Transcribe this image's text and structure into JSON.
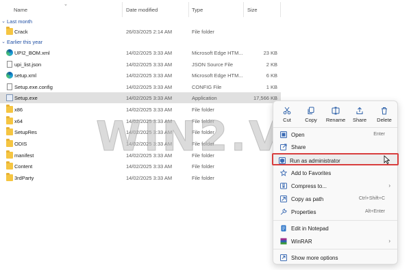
{
  "columns": {
    "name": "Name",
    "date": "Date modified",
    "type": "Type",
    "size": "Size"
  },
  "groups": {
    "last_month": {
      "label": "Last month"
    },
    "earlier": {
      "label": "Earlier this year"
    }
  },
  "files": [
    {
      "name": "Crack",
      "date": "26/03/2025 2:14 AM",
      "type": "File folder",
      "size": "",
      "icon": "folder-icon"
    },
    {
      "name": "UPI2_BOM.xml",
      "date": "14/02/2025 3:33 AM",
      "type": "Microsoft Edge HTM...",
      "size": "23 KB",
      "icon": "edge-icon"
    },
    {
      "name": "upi_list.json",
      "date": "14/02/2025 3:33 AM",
      "type": "JSON Source File",
      "size": "2 KB",
      "icon": "document-icon"
    },
    {
      "name": "setup.xml",
      "date": "14/02/2025 3:33 AM",
      "type": "Microsoft Edge HTM...",
      "size": "6 KB",
      "icon": "edge-icon"
    },
    {
      "name": "Setup.exe.config",
      "date": "14/02/2025 3:33 AM",
      "type": "CONFIG File",
      "size": "1 KB",
      "icon": "document-icon"
    },
    {
      "name": "Setup.exe",
      "date": "14/02/2025 3:33 AM",
      "type": "Application",
      "size": "17,566 KB",
      "icon": "application-icon"
    },
    {
      "name": "x86",
      "date": "14/02/2025 3:33 AM",
      "type": "File folder",
      "size": "",
      "icon": "folder-icon"
    },
    {
      "name": "x64",
      "date": "14/02/2025 3:33 AM",
      "type": "File folder",
      "size": "",
      "icon": "folder-icon"
    },
    {
      "name": "SetupRes",
      "date": "14/02/2025 3:33 AM",
      "type": "File folder",
      "size": "",
      "icon": "folder-icon"
    },
    {
      "name": "ODIS",
      "date": "14/02/2025 3:33 AM",
      "type": "File folder",
      "size": "",
      "icon": "folder-icon"
    },
    {
      "name": "manifest",
      "date": "14/02/2025 3:33 AM",
      "type": "File folder",
      "size": "",
      "icon": "folder-icon"
    },
    {
      "name": "Content",
      "date": "14/02/2025 3:33 AM",
      "type": "File folder",
      "size": "",
      "icon": "folder-icon"
    },
    {
      "name": "3rdParty",
      "date": "14/02/2025 3:33 AM",
      "type": "File folder",
      "size": "",
      "icon": "folder-icon"
    }
  ],
  "watermark": "WIN2.VN",
  "context_menu": {
    "quick_actions": [
      {
        "label": "Cut",
        "icon": "scissors-icon"
      },
      {
        "label": "Copy",
        "icon": "copy-icon"
      },
      {
        "label": "Rename",
        "icon": "rename-icon"
      },
      {
        "label": "Share",
        "icon": "share-icon"
      },
      {
        "label": "Delete",
        "icon": "trash-icon"
      }
    ],
    "items": [
      {
        "label": "Open",
        "shortcut": "Enter",
        "icon": "open-icon"
      },
      {
        "label": "Share",
        "shortcut": "",
        "icon": "share-icon"
      },
      {
        "label": "Run as administrator",
        "shortcut": "",
        "icon": "shield-icon"
      },
      {
        "label": "Add to Favorites",
        "shortcut": "",
        "icon": "star-icon"
      },
      {
        "label": "Compress to...",
        "shortcut": "",
        "icon": "zip-icon"
      },
      {
        "label": "Copy as path",
        "shortcut": "Ctrl+Shift+C",
        "icon": "path-icon"
      },
      {
        "label": "Properties",
        "shortcut": "Alt+Enter",
        "icon": "wrench-icon"
      },
      {
        "label": "Edit in Notepad",
        "shortcut": "",
        "icon": "notepad-icon"
      },
      {
        "label": "WinRAR",
        "shortcut": "",
        "icon": "winrar-icon"
      },
      {
        "label": "Show more options",
        "shortcut": "",
        "icon": "more-options-icon"
      }
    ]
  },
  "colors": {
    "selected_row": "#e0e0e0",
    "highlight_border": "#d83c3c",
    "group_text": "#1f4fa3",
    "folder": "#f5c542"
  }
}
